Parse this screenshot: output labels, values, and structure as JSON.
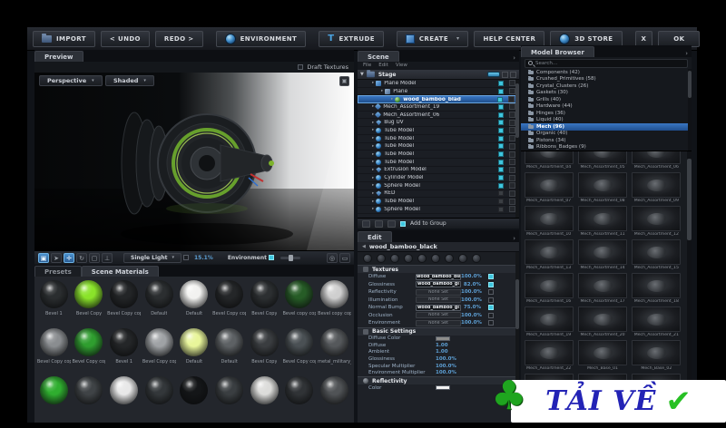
{
  "toolbar": {
    "import": "IMPORT",
    "undo": "< UNDO",
    "redo": "REDO >",
    "environment": "ENVIRONMENT",
    "extrude": "EXTRUDE",
    "create": "CREATE",
    "help_center": "HELP CENTER",
    "store": "3D STORE",
    "close": "X",
    "ok": "OK"
  },
  "preview": {
    "tab": "Preview",
    "draft_textures": "Draft Textures",
    "camera_dropdown": "Perspective",
    "shading_dropdown": "Shaded",
    "light_dropdown": "Single Light",
    "zoom_percent": "15.1%",
    "environment_label": "Environment"
  },
  "materials": {
    "tab_presets": "Presets",
    "tab_scene_materials": "Scene Materials",
    "rows": [
      [
        {
          "label": "Bevel 1",
          "color": "#2a2d2f"
        },
        {
          "label": "Bevel Copy",
          "color": "#8ae32a"
        },
        {
          "label": "Bevel Copy copy",
          "color": "#232527"
        },
        {
          "label": "Default",
          "color": "#2b2e30"
        },
        {
          "label": "Default",
          "color": "#f2f2f0"
        },
        {
          "label": "Bevel Copy copy",
          "color": "#242628"
        },
        {
          "label": "Bevel Copy",
          "color": "#2c2f31"
        },
        {
          "label": "Bevel copy copy",
          "color": "#265c26"
        },
        {
          "label": "Bevel copy copy",
          "color": "#cfcfcf"
        }
      ],
      [
        {
          "label": "Bevel Copy copy",
          "color": "#8a8d90"
        },
        {
          "label": "Bevel Copy copy",
          "color": "#2f9e2f"
        },
        {
          "label": "Bevel 1",
          "color": "#242628"
        },
        {
          "label": "Bevel Copy copy",
          "color": "#9fa2a5"
        },
        {
          "label": "Default",
          "color": "#e8f59a"
        },
        {
          "label": "Default",
          "color": "#5d6164"
        },
        {
          "label": "Bevel Copy",
          "color": "#3a3d40"
        },
        {
          "label": "Bevel Copy copy",
          "color": "#4a5054"
        },
        {
          "label": "metal_military_pai",
          "color": "#55585b"
        }
      ],
      [
        {
          "label": "",
          "color": "#2fae2f"
        },
        {
          "label": "",
          "color": "#3f4346"
        },
        {
          "label": "",
          "color": "#e8e8e8"
        },
        {
          "label": "",
          "color": "#33373a"
        },
        {
          "label": "",
          "color": "#141618"
        },
        {
          "label": "",
          "color": "#3a3e41"
        },
        {
          "label": "",
          "color": "#dcdcda"
        },
        {
          "label": "",
          "color": "#303336"
        },
        {
          "label": "",
          "color": "#505356"
        }
      ]
    ]
  },
  "scene": {
    "tab": "Scene",
    "menu": {
      "file": "File",
      "edit": "Edit",
      "view": "View"
    },
    "root": "Stage",
    "items": [
      {
        "label": "Plane Model",
        "indent": 1,
        "icon": "plane",
        "eye": true
      },
      {
        "label": "Plane",
        "indent": 2,
        "icon": "group",
        "eye": true
      },
      {
        "label": "wood_bamboo_blad",
        "indent": 3,
        "icon": "material",
        "selected": true,
        "eye": true
      },
      {
        "label": "Mech_Assortment_19",
        "indent": 1,
        "icon": "mech",
        "eye": true
      },
      {
        "label": "Mech_Assortment_06",
        "indent": 1,
        "icon": "mech",
        "eye": true
      },
      {
        "label": "Bug UV",
        "indent": 1,
        "icon": "gem",
        "eye": true
      },
      {
        "label": "Tube Model",
        "indent": 1,
        "icon": "tube",
        "eye": true
      },
      {
        "label": "Tube Model",
        "indent": 1,
        "icon": "tube",
        "eye": true
      },
      {
        "label": "Tube Model",
        "indent": 1,
        "icon": "tube",
        "eye": true
      },
      {
        "label": "Tube Model",
        "indent": 1,
        "icon": "tube",
        "eye": true
      },
      {
        "label": "Tube Model",
        "indent": 1,
        "icon": "tube",
        "eye": true
      },
      {
        "label": "Extrusion Model",
        "indent": 1,
        "icon": "gem",
        "eye": true
      },
      {
        "label": "Cylinder Model",
        "indent": 1,
        "icon": "tube",
        "eye": true
      },
      {
        "label": "Sphere Model",
        "indent": 1,
        "icon": "tube",
        "eye": true
      },
      {
        "label": "RED",
        "indent": 1,
        "icon": "gem",
        "eye": false
      },
      {
        "label": "Tube Model",
        "indent": 1,
        "icon": "tube",
        "eye": false
      },
      {
        "label": "Sphere Model",
        "indent": 1,
        "icon": "tube",
        "eye": false
      }
    ],
    "footer_checkbox": "Add to Group"
  },
  "edit": {
    "tab": "Edit",
    "material_name": "wood_bamboo_black",
    "textures": {
      "title": "Textures",
      "rows": [
        {
          "label": "Diffuse",
          "value": "wood_bamboo_bla",
          "percent": "100.0%",
          "checked": true,
          "has_map": true
        },
        {
          "label": "Glossiness",
          "value": "wood_bamboo_gl",
          "percent": "82.0%",
          "checked": true,
          "has_map": true
        },
        {
          "label": "Reflectivity",
          "value": "None Set",
          "percent": "100.0%",
          "checked": false,
          "has_map": false
        },
        {
          "label": "Illumination",
          "value": "None Set",
          "percent": "100.0%",
          "checked": false,
          "has_map": false
        },
        {
          "label": "Normal Bump",
          "value": "wood_bamboo_gl",
          "percent": "75.0%",
          "checked": true,
          "has_map": true
        },
        {
          "label": "Occlusion",
          "value": "None Set",
          "percent": "100.0%",
          "checked": false,
          "has_map": false
        },
        {
          "label": "Environment",
          "value": "None Set",
          "percent": "100.0%",
          "checked": false,
          "has_map": false
        }
      ]
    },
    "basic": {
      "title": "Basic Settings",
      "color_label": "Diffuse Color",
      "rows": [
        {
          "label": "Diffuse",
          "value": "1.00"
        },
        {
          "label": "Ambient",
          "value": "1.00"
        },
        {
          "label": "Glossiness",
          "value": "100.0%"
        },
        {
          "label": "Specular Multiplier",
          "value": "100.0%"
        },
        {
          "label": "Environment Multiplier",
          "value": "100.0%"
        }
      ]
    },
    "reflectivity": {
      "title": "Reflectivity",
      "color_label": "Color"
    }
  },
  "model_browser": {
    "tab": "Model Browser",
    "search_placeholder": "Search...",
    "categories": [
      {
        "label": "Components (42)"
      },
      {
        "label": "Crushed_Primitives (58)"
      },
      {
        "label": "Crystal_Clusters (26)"
      },
      {
        "label": "Gaskets (30)"
      },
      {
        "label": "Grills (40)"
      },
      {
        "label": "Hardware (44)"
      },
      {
        "label": "Hinges (36)"
      },
      {
        "label": "Liquid (40)"
      },
      {
        "label": "Mech (96)",
        "selected": true
      },
      {
        "label": "Organic (40)"
      },
      {
        "label": "Pistons (34)"
      },
      {
        "label": "Ribbons_Badges (9)"
      }
    ],
    "thumbnails": [
      {
        "label": "Mech_Assortment_04"
      },
      {
        "label": "Mech_Assortment_05"
      },
      {
        "label": "Mech_Assortment_06"
      },
      {
        "label": "Mech_Assortment_07"
      },
      {
        "label": "Mech_Assortment_08"
      },
      {
        "label": "Mech_Assortment_09"
      },
      {
        "label": "Mech_Assortment_10"
      },
      {
        "label": "Mech_Assortment_11"
      },
      {
        "label": "Mech_Assortment_12"
      },
      {
        "label": "Mech_Assortment_13"
      },
      {
        "label": "Mech_Assortment_14"
      },
      {
        "label": "Mech_Assortment_15"
      },
      {
        "label": "Mech_Assortment_16"
      },
      {
        "label": "Mech_Assortment_17"
      },
      {
        "label": "Mech_Assortment_18"
      },
      {
        "label": "Mech_Assortment_19"
      },
      {
        "label": "Mech_Assortment_20"
      },
      {
        "label": "Mech_Assortment_21"
      },
      {
        "label": "Mech_Assortment_22"
      },
      {
        "label": "Mech_Base_01"
      },
      {
        "label": "Mech_Base_02"
      },
      {
        "label": ""
      },
      {
        "label": ""
      },
      {
        "label": ""
      }
    ]
  },
  "watermark": {
    "text": "TẢI VỀ"
  },
  "colors": {
    "accent_blue": "#3fa9e0",
    "selection_blue": "#1f4f8e",
    "value_blue": "#5d9fd4",
    "checkbox_cyan": "#3fc6de",
    "material_green": "#8ae32a",
    "watermark_blue": "#2323b5",
    "watermark_green": "#28c024"
  }
}
